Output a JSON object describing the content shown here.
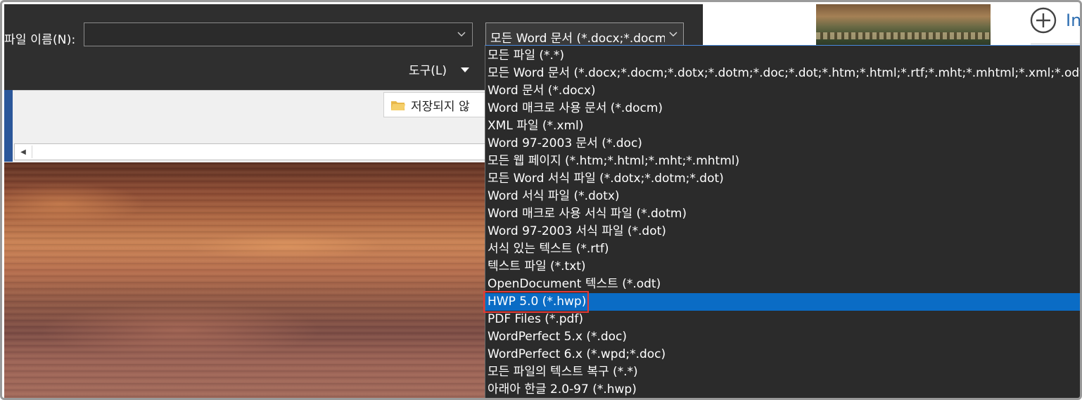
{
  "dialog": {
    "filename_label": "파일 이름(N):",
    "filename_value": "",
    "filetype_selected": "모든 Word 문서 (*.docx;*.docm",
    "tools_label": "도구(L)"
  },
  "background": {
    "folder_item_label": "저장되지 않"
  },
  "right_panel": {
    "partial_text": "In"
  },
  "filetype_options": [
    "모든 파일 (*.*)",
    "모든 Word 문서 (*.docx;*.docm;*.dotx;*.dotm;*.doc;*.dot;*.htm;*.html;*.rtf;*.mht;*.mhtml;*.xml;*.odt;*.pdf)",
    "Word 문서 (*.docx)",
    "Word 매크로 사용 문서 (*.docm)",
    "XML 파일 (*.xml)",
    "Word 97-2003 문서 (*.doc)",
    "모든 웹 페이지 (*.htm;*.html;*.mht;*.mhtml)",
    "모든 Word 서식 파일 (*.dotx;*.dotm;*.dot)",
    "Word 서식 파일 (*.dotx)",
    "Word 매크로 사용 서식 파일 (*.dotm)",
    "Word 97-2003 서식 파일 (*.dot)",
    "서식 있는 텍스트 (*.rtf)",
    "텍스트 파일 (*.txt)",
    "OpenDocument 텍스트 (*.odt)",
    "HWP 5.0 (*.hwp)",
    "PDF Files (*.pdf)",
    "WordPerfect 5.x (*.doc)",
    "WordPerfect 6.x (*.wpd;*.doc)",
    "모든 파일의 텍스트 복구 (*.*)",
    "아래아 한글 2.0-97 (*.hwp)"
  ],
  "selected_option_index": 14,
  "colors": {
    "dialog_bg": "#2f2f2f",
    "selection": "#0a6cc5",
    "annotation": "#e53935"
  }
}
